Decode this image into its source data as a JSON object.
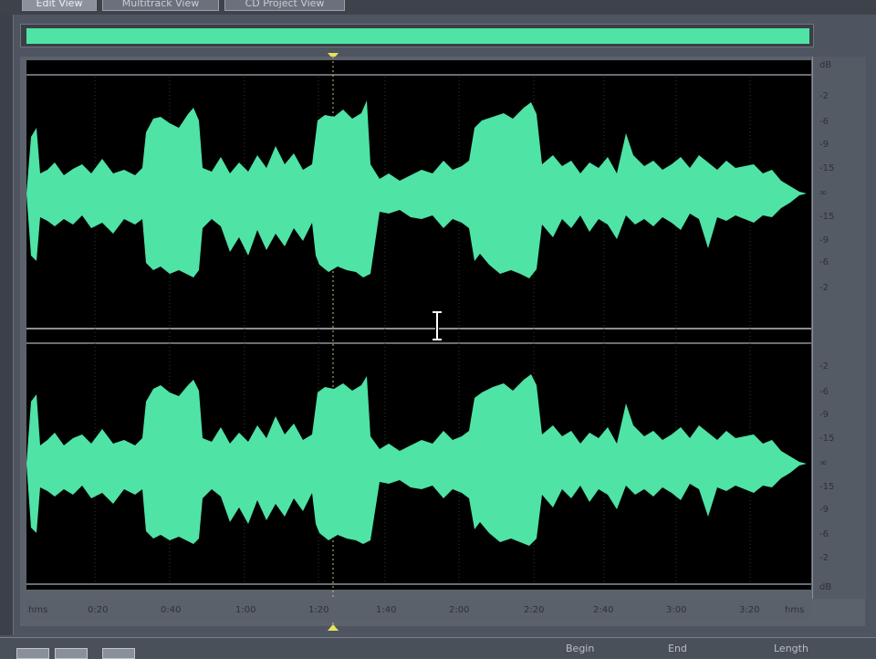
{
  "tabs": [
    "Edit View",
    "Multitrack View",
    "CD Project View"
  ],
  "colors": {
    "waveform": "#4fe3a6",
    "background": "#000000",
    "marker": "#e8e25a"
  },
  "db_scale_top": [
    "dB",
    "-2",
    "-6",
    "-9",
    "-15",
    "∞",
    "-15",
    "-9",
    "-6",
    "-2"
  ],
  "db_scale_bottom": [
    "-2",
    "-6",
    "-9",
    "-15",
    "∞",
    "-15",
    "-9",
    "-6",
    "-2",
    "dB"
  ],
  "timeline_labels": [
    "hms",
    "0:20",
    "0:40",
    "1:00",
    "1:20",
    "1:40",
    "2:00",
    "2:20",
    "2:40",
    "3:00",
    "3:20",
    "hms"
  ],
  "status_labels": [
    "Begin",
    "End",
    "Length"
  ],
  "icons": {
    "cursor": "i-beam-cursor-icon",
    "playhead": "playhead-marker-icon"
  }
}
